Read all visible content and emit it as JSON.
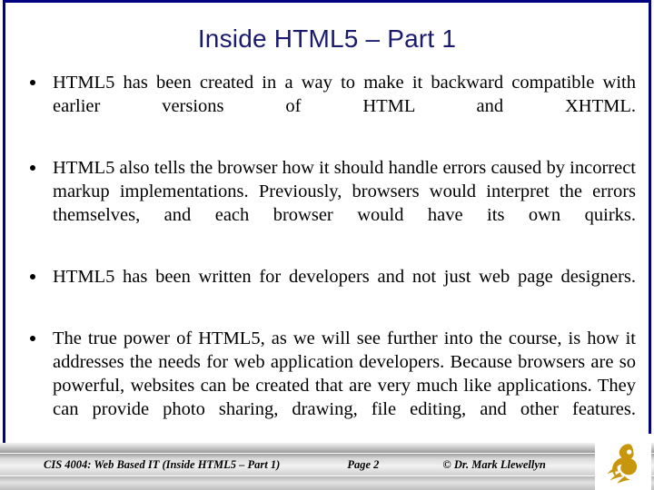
{
  "slide": {
    "title": "Inside HTML5 – Part 1",
    "title_color": "#1a1a70",
    "border_color": "#000080",
    "background_color": "#ffffff",
    "bullets": [
      {
        "text": "HTML5 has been created in a way to make it backward compatible with earlier versions of HTML and XHTML."
      },
      {
        "text": "HTML5 also tells the browser how it should handle errors caused by incorrect markup implementations.  Previously, browsers would interpret the errors themselves, and each browser would have its own quirks."
      },
      {
        "text": "HTML5 has been written for developers and not just web page designers."
      },
      {
        "text": "The true power of HTML5, as we will see further into the course, is how it addresses the needs for web application developers.  Because browsers are so powerful, websites can be created that are very much like applications.  They can provide photo sharing, drawing, file editing, and other features."
      }
    ]
  },
  "footer": {
    "course": "CIS 4004: Web Based IT (Inside HTML5 – Part 1)",
    "page": "Page 2",
    "credit": "© Dr. Mark Llewellyn",
    "logo_name": "ucf-pegasus-logo",
    "logo_color": "#c8960c"
  }
}
